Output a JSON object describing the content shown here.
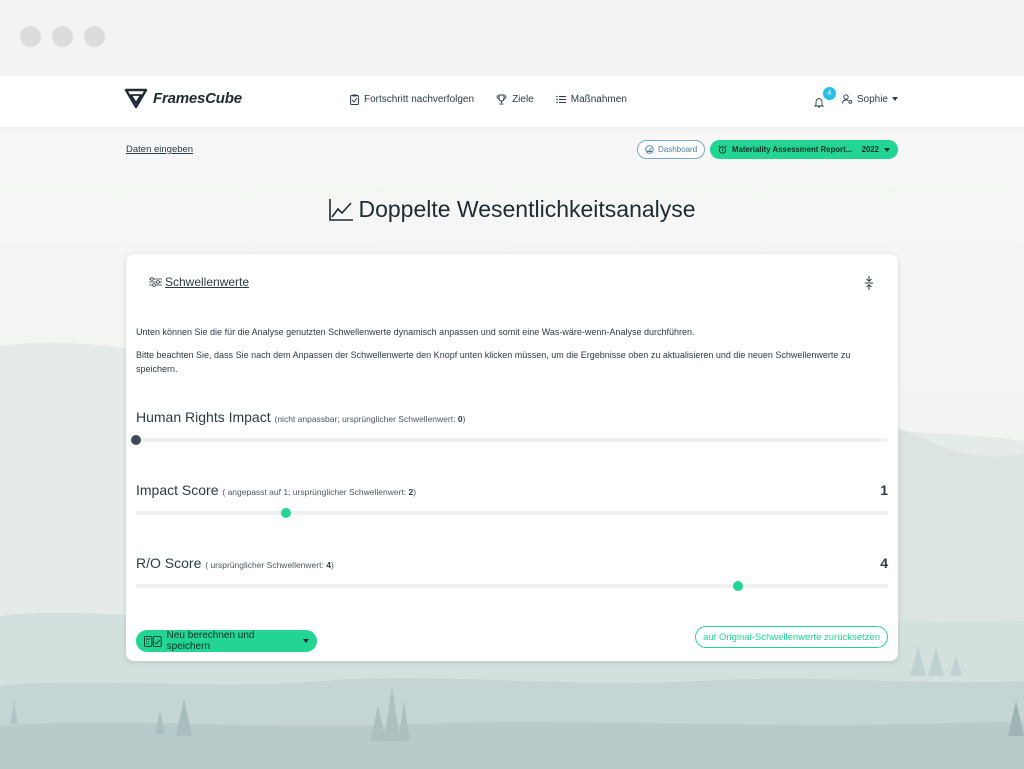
{
  "brand": {
    "name": "FramesCube"
  },
  "nav": {
    "items": [
      {
        "label": "Fortschritt nachverfolgen",
        "icon": "clipboard-icon"
      },
      {
        "label": "Ziele",
        "icon": "trophy-icon"
      },
      {
        "label": "Maßnahmen",
        "icon": "list-icon"
      }
    ],
    "notifications": {
      "count": "4"
    },
    "user": {
      "name": "Sophie"
    }
  },
  "subbar": {
    "breadcrumb": "Daten eingeben",
    "dashboard_label": "Dashboard",
    "report_label": "Materiality Assessment Report...",
    "report_year": "2022"
  },
  "page": {
    "title": "Doppelte Wesentlichkeitsanalyse"
  },
  "card": {
    "heading": "Schwellenwerte",
    "description_1": "Unten können Sie die für die Analyse genutzten Schwellenwerte dynamisch anpassen und somit eine Was-wäre-wenn-Analyse durchführen.",
    "description_2": "Bitte beachten Sie, dass Sie nach dem Anpassen der Schwellenwerte den Knopf unten klicken müssen, um die Ergebnisse oben zu aktualisieren und die neuen Schwellenwerte zu speichern.",
    "sliders": [
      {
        "label": "Human Rights Impact",
        "note_prefix": "(nicht anpassbar; ursprünglicher Schwellenwert:",
        "note_value": "0",
        "note_suffix": ")",
        "value": "",
        "fraction": 0.0,
        "color": "#3c4a55"
      },
      {
        "label": "Impact Score",
        "note_prefix": "( angepasst auf 1; ursprünglicher Schwellenwert:",
        "note_value": "2",
        "note_suffix": ")",
        "value": "1",
        "fraction": 0.2,
        "color": "#22d593"
      },
      {
        "label": "R/O Score",
        "note_prefix": "( ursprünglicher Schwellenwert:",
        "note_value": "4",
        "note_suffix": ")",
        "value": "4",
        "fraction": 0.8,
        "color": "#22d593"
      }
    ],
    "save_label": "Neu berechnen und speichern",
    "reset_label": "auf Original-Schwellenwerte zurücksetzen"
  },
  "colors": {
    "accent": "#22d593",
    "badge": "#28c0e8",
    "text": "#2b3a45"
  }
}
